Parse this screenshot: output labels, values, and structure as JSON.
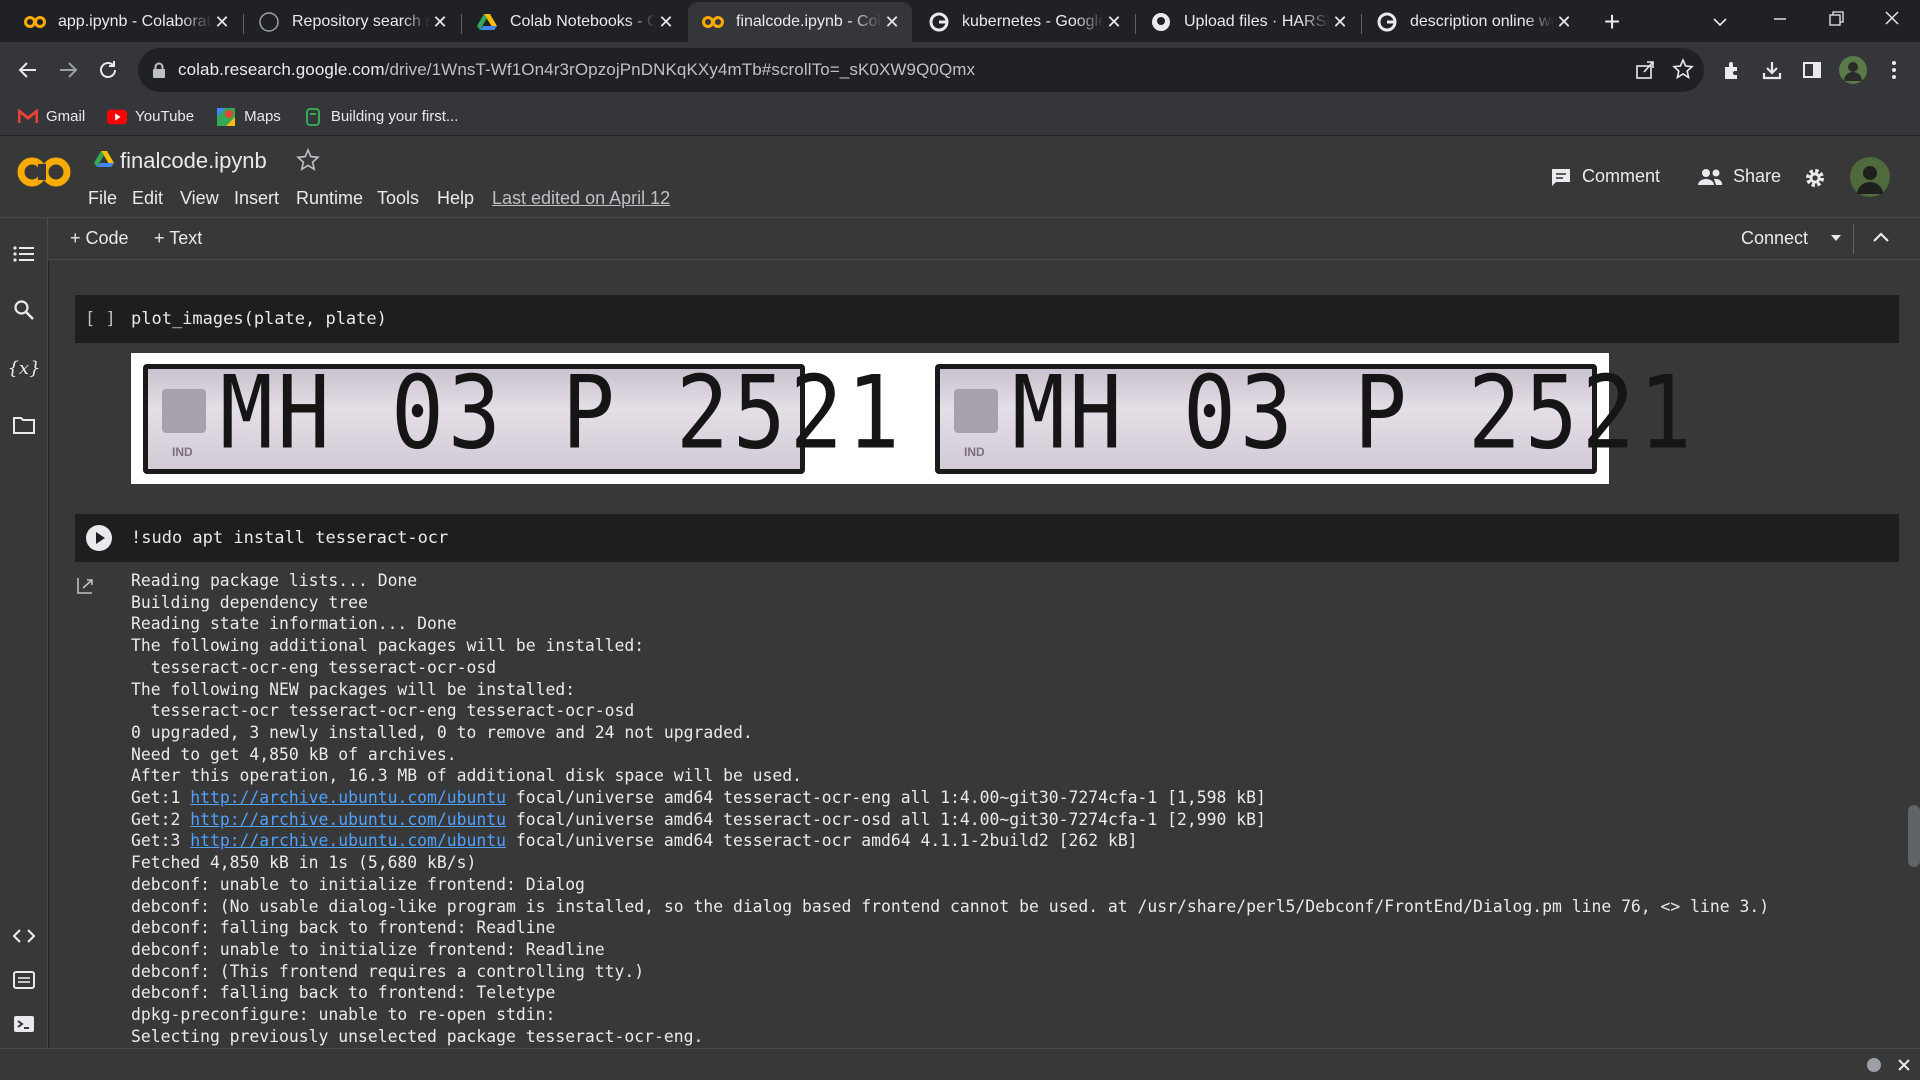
{
  "tabs": [
    {
      "title": "app.ipynb - Colaboratory",
      "icon": "colab-icon"
    },
    {
      "title": "Repository search results",
      "icon": "github-icon"
    },
    {
      "title": "Colab Notebooks - Google Drive",
      "icon": "drive-icon"
    },
    {
      "title": "finalcode.ipynb - Colaboratory",
      "icon": "colab-icon",
      "active": true
    },
    {
      "title": "kubernetes - Google Search",
      "icon": "google-icon"
    },
    {
      "title": "Upload files · HARSHA",
      "icon": "github-icon"
    },
    {
      "title": "description online writer",
      "icon": "google-icon"
    }
  ],
  "toolbar": {
    "url_host": "colab.research.google.com",
    "url_path": "/drive/1WnsT-Wf1On4r3rOpzojPnDNKqKXy4mTb#scrollTo=_sK0XW9Q0Qmx"
  },
  "bookmarks": [
    {
      "label": "Gmail",
      "icon": "gmail-icon"
    },
    {
      "label": "YouTube",
      "icon": "youtube-icon"
    },
    {
      "label": "Maps",
      "icon": "maps-icon"
    },
    {
      "label": "Building your first...",
      "icon": "bookmark-page-icon"
    }
  ],
  "colab": {
    "filename": "finalcode.ipynb",
    "menu": [
      "File",
      "Edit",
      "View",
      "Insert",
      "Runtime",
      "Tools",
      "Help"
    ],
    "last_edited": "Last edited on April 12",
    "comment": "Comment",
    "share": "Share",
    "add_code": "+ Code",
    "add_text": "+ Text",
    "connect": "Connect"
  },
  "cells": {
    "cell1_bracket": "[ ]",
    "cell1_code": "plot_images(plate, plate)",
    "cell2_code": "!sudo apt install tesseract-ocr",
    "plate_text": "MH 03 P 2521",
    "plate_state": "IND"
  },
  "output": {
    "lines_before": [
      "Reading package lists... Done",
      "Building dependency tree",
      "Reading state information... Done",
      "The following additional packages will be installed:",
      "  tesseract-ocr-eng tesseract-ocr-osd",
      "The following NEW packages will be installed:",
      "  tesseract-ocr tesseract-ocr-eng tesseract-ocr-osd",
      "0 upgraded, 3 newly installed, 0 to remove and 24 not upgraded.",
      "Need to get 4,850 kB of archives.",
      "After this operation, 16.3 MB of additional disk space will be used."
    ],
    "get_lines": [
      {
        "prefix": "Get:1 ",
        "link": "http://archive.ubuntu.com/ubuntu",
        "rest": " focal/universe amd64 tesseract-ocr-eng all 1:4.00~git30-7274cfa-1 [1,598 kB]"
      },
      {
        "prefix": "Get:2 ",
        "link": "http://archive.ubuntu.com/ubuntu",
        "rest": " focal/universe amd64 tesseract-ocr-osd all 1:4.00~git30-7274cfa-1 [2,990 kB]"
      },
      {
        "prefix": "Get:3 ",
        "link": "http://archive.ubuntu.com/ubuntu",
        "rest": " focal/universe amd64 tesseract-ocr amd64 4.1.1-2build2 [262 kB]"
      }
    ],
    "lines_after": [
      "Fetched 4,850 kB in 1s (5,680 kB/s)",
      "debconf: unable to initialize frontend: Dialog",
      "debconf: (No usable dialog-like program is installed, so the dialog based frontend cannot be used. at /usr/share/perl5/Debconf/FrontEnd/Dialog.pm line 76, <> line 3.)",
      "debconf: falling back to frontend: Readline",
      "debconf: unable to initialize frontend: Readline",
      "debconf: (This frontend requires a controlling tty.)",
      "debconf: falling back to frontend: Teletype",
      "dpkg-preconfigure: unable to re-open stdin:",
      "Selecting previously unselected package tesseract-ocr-eng."
    ]
  },
  "colors": {
    "colab_orange": "#f9ab00",
    "link": "#4ea1ff",
    "background": "#383838"
  }
}
